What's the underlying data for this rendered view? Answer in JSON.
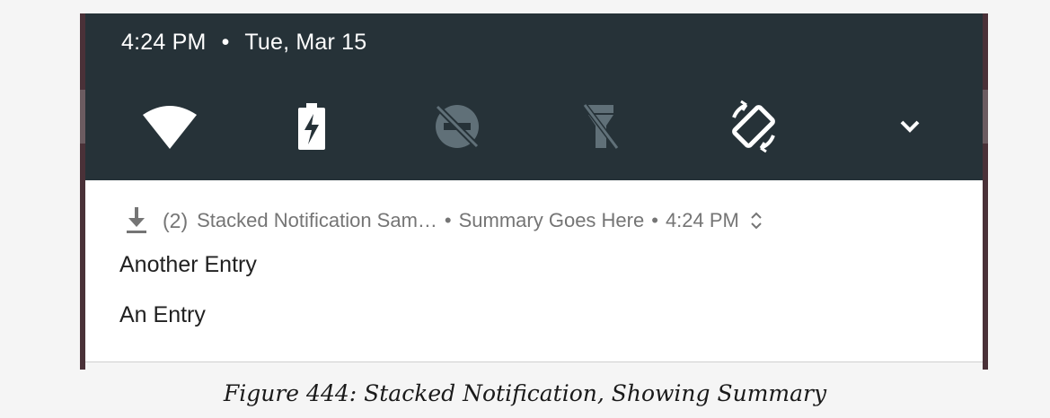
{
  "status_bar": {
    "time": "4:24 PM",
    "separator": "•",
    "date": "Tue, Mar 15"
  },
  "quick_settings": [
    {
      "icon": "wifi-icon"
    },
    {
      "icon": "battery-charging-icon"
    },
    {
      "icon": "do-not-disturb-off-icon"
    },
    {
      "icon": "flashlight-off-icon"
    },
    {
      "icon": "auto-rotate-icon"
    },
    {
      "icon": "expand-chevron-icon"
    }
  ],
  "notification": {
    "count": "(2)",
    "app_name": "Stacked Notification Sam…",
    "separator": "•",
    "summary": "Summary Goes Here",
    "time": "4:24 PM",
    "entries": [
      "Another Entry",
      "An Entry"
    ]
  },
  "caption": "Figure 444: Stacked Notification, Showing Summary",
  "colors": {
    "shade_background": "#263238",
    "card_background": "#ffffff",
    "secondary_text": "#757575",
    "primary_text": "#212121",
    "disabled_icon": "#607078"
  }
}
